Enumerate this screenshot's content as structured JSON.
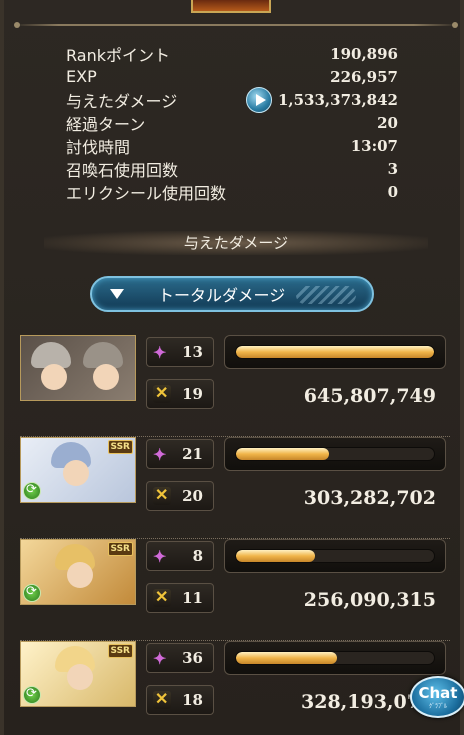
{
  "summary": {
    "rows": [
      {
        "label": "Rankポイント",
        "value": "190,896"
      },
      {
        "label": "EXP",
        "value": "226,957"
      },
      {
        "label": "与えたダメージ",
        "value": "1,533,373,842",
        "play_icon": "play-icon"
      },
      {
        "label": "経過ターン",
        "value": "20"
      },
      {
        "label": "討伐時間",
        "value": "13:07"
      },
      {
        "label": "召喚石使用回数",
        "value": "3"
      },
      {
        "label": "エリクシール使用回数",
        "value": "0"
      }
    ]
  },
  "section": {
    "title": "与えたダメージ"
  },
  "dropdown": {
    "label": "トータルダメージ"
  },
  "characters": [
    {
      "skills": "13",
      "ca": "19",
      "damage": "645,807,749",
      "bar_fraction": 1.0,
      "ssr": "",
      "element": ""
    },
    {
      "skills": "21",
      "ca": "20",
      "damage": "303,282,702",
      "bar_fraction": 0.47,
      "ssr": "SSR",
      "element": "wind"
    },
    {
      "skills": "8",
      "ca": "11",
      "damage": "256,090,315",
      "bar_fraction": 0.4,
      "ssr": "SSR",
      "element": "wind"
    },
    {
      "skills": "36",
      "ca": "18",
      "damage": "328,193,07",
      "bar_fraction": 0.51,
      "ssr": "SSR",
      "element": "wind"
    }
  ],
  "chat": {
    "label": "Chat",
    "sub": "ｸﾞﾗﾌﾞﾙ"
  },
  "colors": {
    "accent": "#2a7ca3",
    "bar": "#f0b54a",
    "wind": "#6fcf4a"
  }
}
